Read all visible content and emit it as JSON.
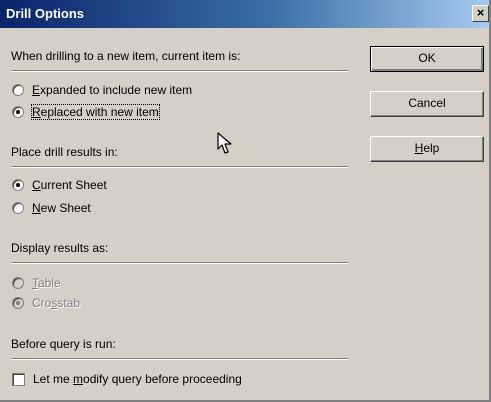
{
  "dialog": {
    "title": "Drill Options",
    "close_label": "×"
  },
  "sections": {
    "drill_label": "When drilling to a new item, current item is:",
    "results_label": "Place drill results in:",
    "display_label": "Display results as:",
    "query_label": "Before query is run:"
  },
  "drill_options": [
    {
      "mnemonic": "E",
      "rest": "xpanded to include new item",
      "checked": false
    },
    {
      "mnemonic": "R",
      "rest": "eplaced with new item",
      "checked": true
    }
  ],
  "results_options": [
    {
      "mnemonic": "C",
      "rest": "urrent Sheet",
      "checked": true
    },
    {
      "mnemonic": "N",
      "rest": "ew Sheet",
      "checked": false
    }
  ],
  "display_options": [
    {
      "mnemonic": "T",
      "rest": "able",
      "pre": "",
      "checked": false,
      "enabled": false
    },
    {
      "pre": "Cro",
      "mnemonic": "s",
      "rest": "stab",
      "checked": true,
      "enabled": false
    }
  ],
  "query_option": {
    "pre": "Let me ",
    "mnemonic": "m",
    "rest": "odify query before proceeding",
    "checked": false
  },
  "buttons": {
    "ok": "OK",
    "cancel": "Cancel",
    "help_mnemonic": "H",
    "help_rest": "elp"
  }
}
